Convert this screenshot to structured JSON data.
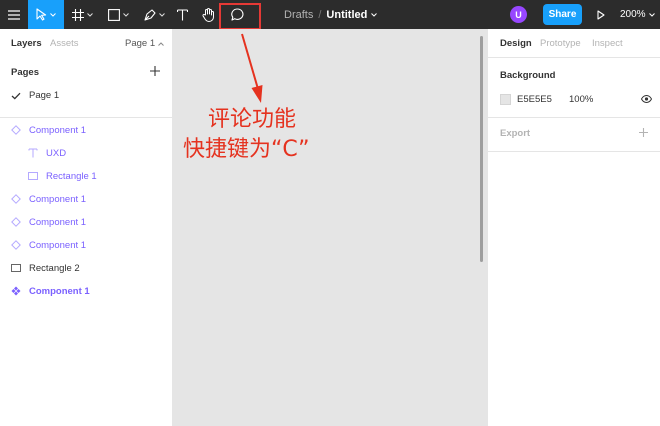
{
  "toolbar": {
    "file": {
      "drafts": "Drafts",
      "separator": "/",
      "name": "Untitled"
    },
    "avatar_initial": "U",
    "share_label": "Share",
    "zoom": "200%",
    "tools": [
      "menu-icon",
      "move-icon",
      "frame-icon",
      "rectangle-icon",
      "pen-icon",
      "text-icon",
      "hand-icon",
      "comment-icon"
    ]
  },
  "left_panel": {
    "tabs": {
      "layers": "Layers",
      "assets": "Assets"
    },
    "page_selector": "Page 1",
    "pages_heading": "Pages",
    "pages": [
      {
        "label": "Page 1",
        "selected": true
      }
    ],
    "layers": [
      {
        "label": "Component 1",
        "icon": "component-icon"
      },
      {
        "label": "UXD",
        "icon": "text-icon"
      },
      {
        "label": "Rectangle 1",
        "icon": "rectangle-icon"
      },
      {
        "label": "Component 1",
        "icon": "component-icon"
      },
      {
        "label": "Component 1",
        "icon": "component-icon"
      },
      {
        "label": "Component 1",
        "icon": "component-icon"
      },
      {
        "label": "Rectangle 2",
        "icon": "rectangle-icon"
      },
      {
        "label": "Component 1",
        "icon": "main-component-icon",
        "selected": true
      }
    ]
  },
  "annotation": {
    "line1": "评论功能",
    "line2": "快捷键为“C”"
  },
  "right_panel": {
    "tabs": {
      "design": "Design",
      "prototype": "Prototype",
      "inspect": "Inspect"
    },
    "background": {
      "heading": "Background",
      "hex": "E5E5E5",
      "opacity": "100%"
    },
    "export": {
      "heading": "Export"
    }
  },
  "colors": {
    "toolbar": "#2c2c2c",
    "accent": "#18a0fb",
    "component": "#7b61ff",
    "canvas": "#e5e5e5",
    "annotation": "#e5321f",
    "avatar": "#9747ff"
  }
}
